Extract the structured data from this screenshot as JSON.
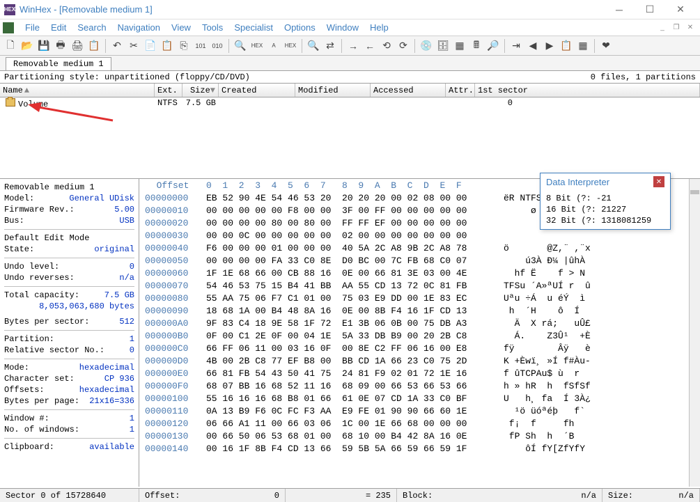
{
  "title": "WinHex - [Removable medium 1]",
  "menu": [
    "File",
    "Edit",
    "Search",
    "Navigation",
    "View",
    "Tools",
    "Specialist",
    "Options",
    "Window",
    "Help"
  ],
  "tab": "Removable medium 1",
  "partline_left": "Partitioning style: unpartitioned (floppy/CD/DVD)",
  "partline_right": "0 files, 1 partitions",
  "cols": {
    "name": "Name",
    "ext": "Ext.",
    "size": "Size",
    "created": "Created",
    "modified": "Modified",
    "accessed": "Accessed",
    "attr": "Attr.",
    "sector": "1st sector"
  },
  "row": {
    "name": "Volume",
    "ext": "NTFS",
    "size": "7.5 GB",
    "sector": "0"
  },
  "side": {
    "header": "Removable medium 1",
    "model_l": "Model:",
    "model_v": "General UDisk",
    "fw_l": "Firmware Rev.:",
    "fw_v": "5.00",
    "bus_l": "Bus:",
    "bus_v": "USB",
    "dem_l": "Default Edit Mode",
    "state_l": "State:",
    "state_v": "original",
    "undo_l": "Undo level:",
    "undo_v": "0",
    "undor_l": "Undo reverses:",
    "undor_v": "n/a",
    "cap_l": "Total capacity:",
    "cap_v": "7.5 GB",
    "cap2": "8,053,063,680 bytes",
    "bps_l": "Bytes per sector:",
    "bps_v": "512",
    "part_l": "Partition:",
    "part_v": "1",
    "rsn_l": "Relative sector No.:",
    "rsn_v": "0",
    "mode_l": "Mode:",
    "mode_v": "hexadecimal",
    "cs_l": "Character set:",
    "cs_v": "CP 936",
    "off_l": "Offsets:",
    "off_v": "hexadecimal",
    "bpp_l": "Bytes per page:",
    "bpp_v": "21x16=336",
    "win_l": "Window #:",
    "win_v": "1",
    "now_l": "No. of windows:",
    "now_v": "1",
    "clip_l": "Clipboard:",
    "clip_v": "available"
  },
  "hex": {
    "offset_label": "Offset",
    "header": "0  1  2  3  4  5  6  7   8  9  A  B  C  D  E  F",
    "rows": [
      {
        "o": "00000000",
        "b": "EB 52 90 4E 54 46 53 20  20 20 20 00 02 08 00 00",
        "a": "ëR NTFS"
      },
      {
        "o": "00000010",
        "b": "00 00 00 00 00 F8 00 00  3F 00 FF 00 00 00 00 00",
        "a": "     ø  ? ÿ"
      },
      {
        "o": "00000020",
        "b": "00 00 00 00 80 00 80 00  FF FF EF 00 00 00 00 00",
        "a": "        ÿÿï"
      },
      {
        "o": "00000030",
        "b": "00 00 0C 00 00 00 00 00  02 00 00 00 00 00 00 00",
        "a": ""
      },
      {
        "o": "00000040",
        "b": "F6 00 00 00 01 00 00 00  40 5A 2C A8 9B 2C A8 78",
        "a": "ö       @Z,¨ ,¨x"
      },
      {
        "o": "00000050",
        "b": "00 00 00 00 FA 33 C0 8E  D0 BC 00 7C FB 68 C0 07",
        "a": "    ú3À Ð¼ |ûhÀ"
      },
      {
        "o": "00000060",
        "b": "1F 1E 68 66 00 CB 88 16  0E 00 66 81 3E 03 00 4E",
        "a": "  hf Ë    f > N"
      },
      {
        "o": "00000070",
        "b": "54 46 53 75 15 B4 41 BB  AA 55 CD 13 72 0C 81 FB",
        "a": "TFSu ´A»ªUÍ r  û"
      },
      {
        "o": "00000080",
        "b": "55 AA 75 06 F7 C1 01 00  75 03 E9 DD 00 1E 83 EC",
        "a": "Uªu ÷Á  u éÝ  ì"
      },
      {
        "o": "00000090",
        "b": "18 68 1A 00 B4 48 8A 16  0E 00 8B F4 16 1F CD 13",
        "a": " h  ´H    ô  Í"
      },
      {
        "o": "000000A0",
        "b": "9F 83 C4 18 9E 58 1F 72  E1 3B 06 0B 00 75 DB A3",
        "a": "  Ä  X rá;   uÛ£"
      },
      {
        "o": "000000B0",
        "b": "0F 00 C1 2E 0F 00 04 1E  5A 33 DB B9 00 20 2B C8",
        "a": "  Á.    Z3Û¹  +È"
      },
      {
        "o": "000000C0",
        "b": "66 FF 06 11 00 03 16 0F  00 8E C2 FF 06 16 00 E8",
        "a": "fÿ        Âÿ   è"
      },
      {
        "o": "000000D0",
        "b": "4B 00 2B C8 77 EF B8 00  BB CD 1A 66 23 C0 75 2D",
        "a": "K +Èwï¸ »Í f#Àu-"
      },
      {
        "o": "000000E0",
        "b": "66 81 FB 54 43 50 41 75  24 81 F9 02 01 72 1E 16",
        "a": "f ûTCPAu$ ù  r"
      },
      {
        "o": "000000F0",
        "b": "68 07 BB 16 68 52 11 16  68 09 00 66 53 66 53 66",
        "a": "h » hR  h  fSfSf"
      },
      {
        "o": "00000100",
        "b": "55 16 16 16 68 B8 01 66  61 0E 07 CD 1A 33 C0 BF",
        "a": "U   h¸ fa  Í 3À¿"
      },
      {
        "o": "00000110",
        "b": "0A 13 B9 F6 0C FC F3 AA  E9 FE 01 90 90 66 60 1E",
        "a": "  ¹ö üóªéþ   f`"
      },
      {
        "o": "00000120",
        "b": "06 66 A1 11 00 66 03 06  1C 00 1E 66 68 00 00 00",
        "a": " f¡  f     fh"
      },
      {
        "o": "00000130",
        "b": "00 66 50 06 53 68 01 00  68 10 00 B4 42 8A 16 0E",
        "a": " fP Sh  h  ´B"
      },
      {
        "o": "00000140",
        "b": "00 16 1F 8B F4 CD 13 66  59 5B 5A 66 59 66 59 1F",
        "a": "    ôÍ fY[ZfYfY"
      }
    ]
  },
  "di": {
    "title": "Data Interpreter",
    "b8": "8 Bit (?: -21",
    "b16": "16 Bit (?: 21227",
    "b32": "32 Bit (?: 1318081259"
  },
  "status": {
    "sector": "Sector 0 of 15728640",
    "offset_l": "Offset:",
    "offset_v": "0",
    "eq": "= 235",
    "block_l": "Block:",
    "block_v": "n/a",
    "size_l": "Size:",
    "size_v": "n/a"
  }
}
